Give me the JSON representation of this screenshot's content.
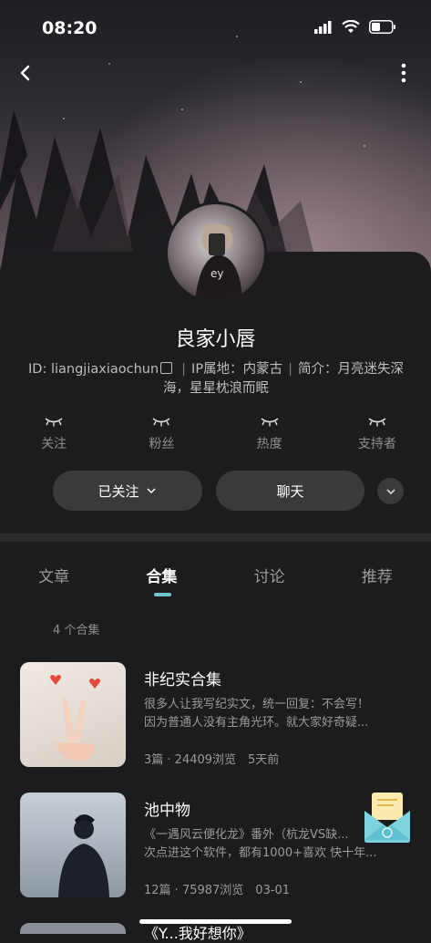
{
  "status_bar": {
    "time": "08:20"
  },
  "profile": {
    "username": "良家小唇",
    "id_text": "ID: liangjiaxiaochun",
    "ip_text": "IP属地：内蒙古",
    "bio_text": "简介：月亮迷失深海，星星枕浪而眠"
  },
  "stats": [
    {
      "label": "关注"
    },
    {
      "label": "粉丝"
    },
    {
      "label": "热度"
    },
    {
      "label": "支持者"
    }
  ],
  "actions": {
    "follow_label": "已关注",
    "chat_label": "聊天"
  },
  "tabs": [
    {
      "label": "文章",
      "active": false
    },
    {
      "label": "合集",
      "active": true
    },
    {
      "label": "讨论",
      "active": false
    },
    {
      "label": "推荐",
      "active": false
    }
  ],
  "collection_count": "4 个合集",
  "collections": [
    {
      "title": "非纪实合集",
      "desc_line1": "很多人让我写纪实文，统一回复：不会写！",
      "desc_line2": "因为普通人没有主角光环。就大家好奇疑...",
      "meta": "3篇 · 24409浏览　5天前"
    },
    {
      "title": "池中物",
      "desc_line1": "《一遇风云便化龙》番外（杭龙VS缺...",
      "desc_line2": "次点进这个软件，都有1000+喜欢 快十年...",
      "meta": "12篇 · 75987浏览　03-01"
    },
    {
      "title": "《Y...我好想你》"
    }
  ],
  "colors": {
    "accent": "#6dc5c7",
    "background": "#1c1c1e",
    "button": "#3a3a3c"
  }
}
